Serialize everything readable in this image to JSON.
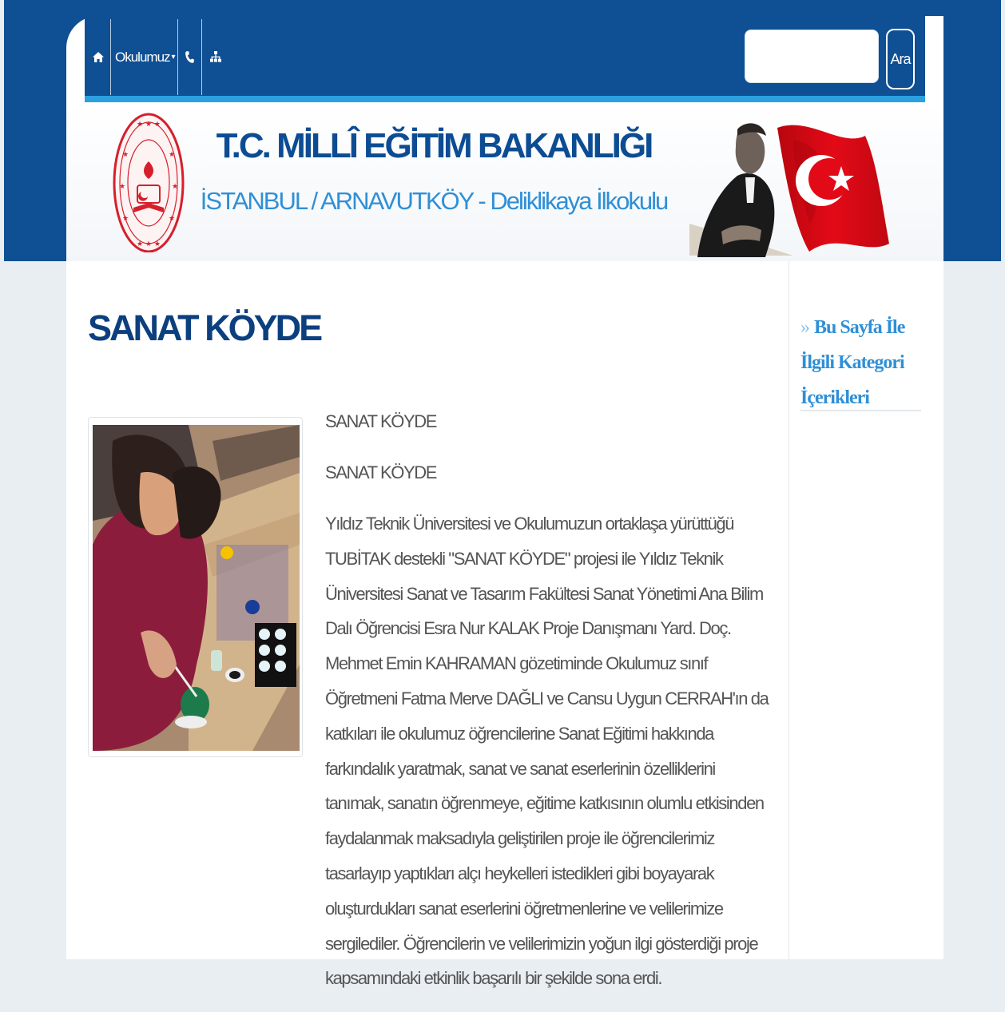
{
  "nav": {
    "home_icon": "home-icon",
    "menu_label": "Okulumuz",
    "phone_icon": "phone-icon",
    "sitemap_icon": "sitemap-icon",
    "search_placeholder": "",
    "search_button": "Ara"
  },
  "header": {
    "ministry_title": "T.C. MİLLÎ EĞİTİM BAKANLIĞI",
    "school_name": "İSTANBUL / ARNAVUTKÖY - Deliklikaya İlkokulu"
  },
  "main": {
    "heading": "SANAT KÖYDE",
    "subtitle_1": "SANAT KÖYDE",
    "subtitle_2": "SANAT KÖYDE",
    "body": "Yıldız Teknik Üniversitesi  ve Okulumuzun ortaklaşa yürüttüğü TUBİTAK destekli \"SANAT KÖYDE\" projesi ile Yıldız Teknik Üniversitesi Sanat ve Tasarım Fakültesi  Sanat Yönetimi Ana Bilim Dalı Öğrencisi Esra Nur KALAK Proje Danışmanı Yard. Doç. Mehmet Emin KAHRAMAN gözetiminde  Okulumuz sınıf Öğretmeni Fatma Merve DAĞLI  ve Cansu Uygun CERRAH'ın da  katkıları ile okulumuz öğrencilerine Sanat Eğitimi hakkında farkındalık yaratmak, sanat ve sanat eserlerinin özelliklerini tanımak,  sanatın öğrenmeye, eğitime katkısının olumlu etkisinden faydalanmak maksadıyla geliştirilen proje ile öğrencilerimiz tasarlayıp yaptıkları alçı heykelleri istedikleri gibi boyayarak oluşturdukları sanat eserlerini öğretmenlerine ve velilerimize sergilediler.  Öğrencilerin ve velilerimizin yoğun ilgi gösterdiği proje kapsamındaki etkinlik başarılı bir şekilde sona erdi."
  },
  "sidebar": {
    "heading": "Bu Sayfa İle İlgili Kategori İçerikleri"
  },
  "colors": {
    "brand_blue": "#0f4f93",
    "accent_blue": "#2f8fd6",
    "flag_red": "#e30a17"
  }
}
